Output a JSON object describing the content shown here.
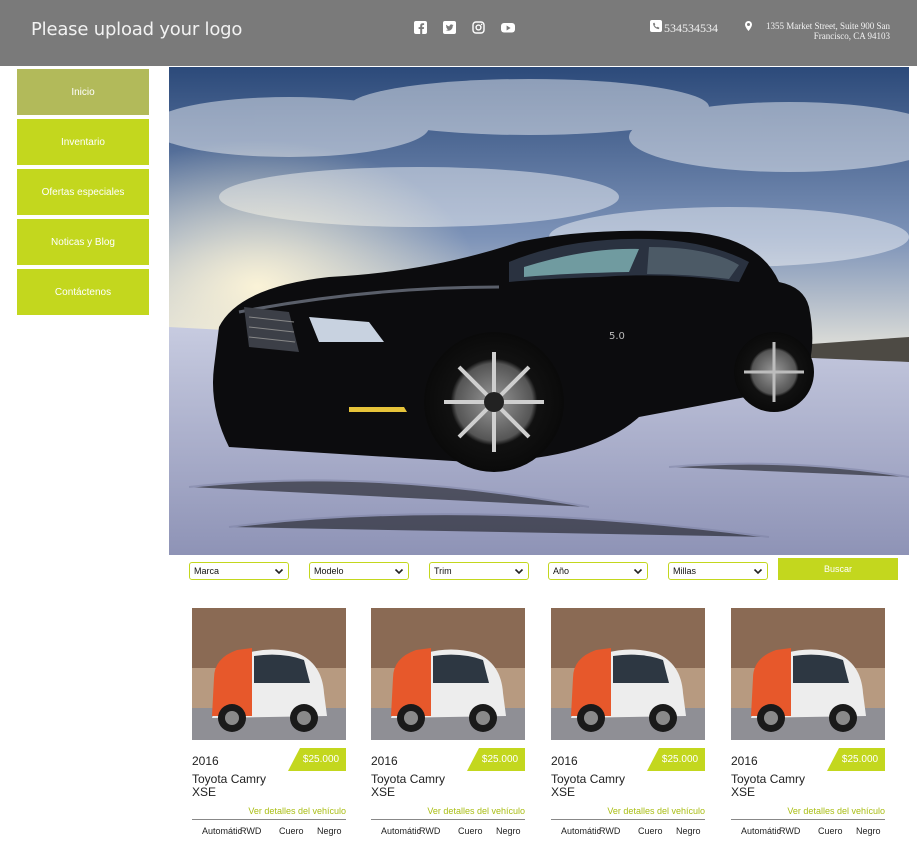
{
  "header": {
    "logo_text": "Please upload your logo",
    "social_icons": [
      "facebook-icon",
      "twitter-icon",
      "instagram-icon",
      "youtube-icon"
    ],
    "phone": "534534534",
    "address_line1": "1355 Market Street, Suite 900 San",
    "address_line2": "Francisco, CA 94103"
  },
  "sidebar": {
    "items": [
      {
        "label": "Inicio"
      },
      {
        "label": "Inventario"
      },
      {
        "label": "Ofertas especiales"
      },
      {
        "label": "Noticas y Blog"
      },
      {
        "label": "Contáctenos"
      }
    ]
  },
  "search": {
    "filters": [
      "Marca",
      "Modelo",
      "Trim",
      "Año",
      "Millas"
    ],
    "button_label": "Buscar"
  },
  "listings": [
    {
      "year": "2016",
      "price": "$25.000",
      "model_line1": "Toyota Camry",
      "model_line2": "XSE",
      "details_label": "Ver detalles del vehículo",
      "transmission": "Automátic",
      "drive": "RWD",
      "interior": "Cuero",
      "color": "Negro"
    },
    {
      "year": "2016",
      "price": "$25.000",
      "model_line1": "Toyota Camry",
      "model_line2": "XSE",
      "details_label": "Ver detalles del vehículo",
      "transmission": "Automátic",
      "drive": "RWD",
      "interior": "Cuero",
      "color": "Negro"
    },
    {
      "year": "2016",
      "price": "$25.000",
      "model_line1": "Toyota Camry",
      "model_line2": "XSE",
      "details_label": "Ver detalles del vehículo",
      "transmission": "Automátic",
      "drive": "RWD",
      "interior": "Cuero",
      "color": "Negro"
    },
    {
      "year": "2016",
      "price": "$25.000",
      "model_line1": "Toyota Camry",
      "model_line2": "XSE",
      "details_label": "Ver detalles del vehículo",
      "transmission": "Automátic",
      "drive": "RWD",
      "interior": "Cuero",
      "color": "Negro"
    }
  ],
  "colors": {
    "accent": "#c3d71e",
    "nav_active": "#b2ba5a",
    "header_bg": "#7a7a7a"
  }
}
